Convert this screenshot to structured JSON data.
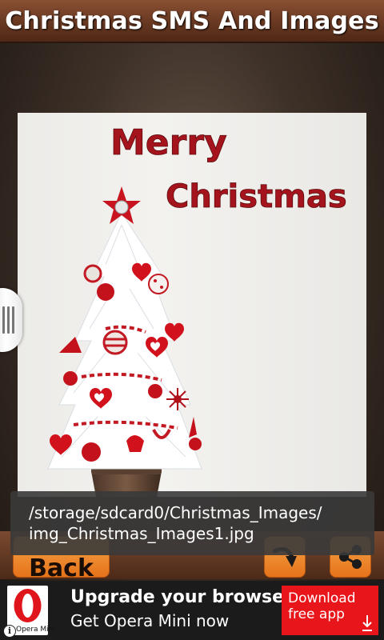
{
  "app": {
    "title": "Christmas SMS And Images"
  },
  "image": {
    "greeting_line1": "Merry",
    "greeting_line2": "Christmas"
  },
  "toast": {
    "path_line1": "/storage/sdcard0/Christmas_Images/",
    "path_line2": "img_Christmas_Images1.jpg"
  },
  "toolbar": {
    "back_label": "Back",
    "download_icon": "download-arrow-icon",
    "share_icon": "share-icon"
  },
  "ad": {
    "logo_label": "Opera Mini",
    "headline": "Upgrade your browser",
    "subline": "Get Opera Mini now",
    "cta_line1": "Download",
    "cta_line2": "free app",
    "info_icon": "i"
  },
  "colors": {
    "title_bar": "#6e3c24",
    "button_orange": "#f08a2c",
    "ad_red": "#e8161b",
    "greeting_red": "#a5141c"
  }
}
